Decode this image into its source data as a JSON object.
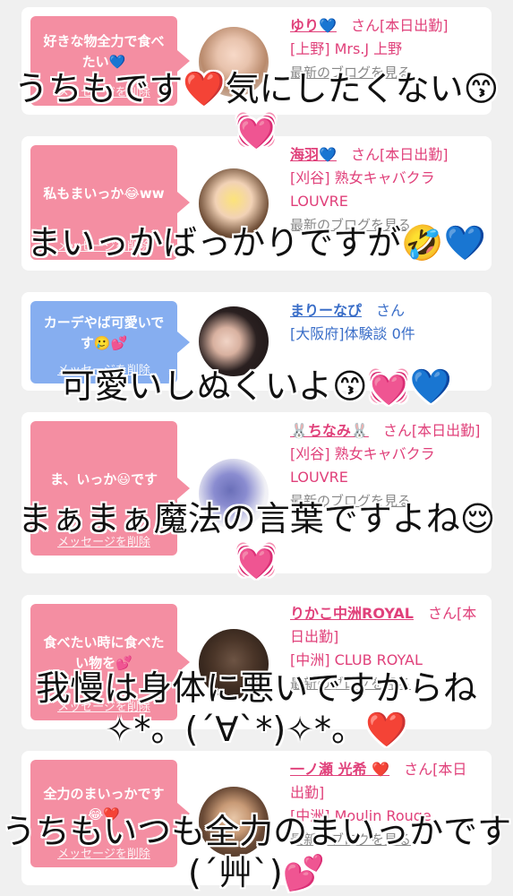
{
  "delete_label": "メッセージを削除",
  "san": "さん",
  "blog_label": "最新のブログを見る",
  "cards": [
    {
      "bubble": "好きな物全力で食べたい💙",
      "name": "ゆり💙",
      "status": "[本日出勤]",
      "shop": "[上野] Mrs.J 上野",
      "color": "pink"
    },
    {
      "bubble": "私もまいっか😂ww",
      "name": "海羽💙",
      "status": "[本日出勤]",
      "shop": "[刈谷] 熟女キャバクラ LOUVRE",
      "color": "pink"
    },
    {
      "bubble": "カーデやば可愛いです🥲💕",
      "name": "まりーなぴ",
      "status": "",
      "shop": "[大阪府]体験談 0件",
      "color": "blue"
    },
    {
      "bubble": "ま、いっか😃です",
      "name": "🐰ちなみ🐰",
      "status": "[本日出勤]",
      "shop": "[刈谷] 熟女キャバクラ LOUVRE",
      "color": "pink"
    },
    {
      "bubble": "食べたい時に食べたい物を💕",
      "name": "りかこ中洲ROYAL",
      "status": "[本日出勤]",
      "shop": "[中洲] CLUB ROYAL",
      "color": "pink"
    },
    {
      "bubble": "全力のまいっかです😂❤️",
      "name": "一ノ瀬 光希 ❤️",
      "status": "[本日出勤]",
      "shop": "[中洲] Moulin Rouge",
      "color": "pink"
    }
  ],
  "overlays": [
    "うちもです❤️気にしたくない😙💓",
    "まいっかばっかりですが🤣💙",
    "可愛いしぬくいよ😙💓💙",
    "まぁまぁ魔法の言葉ですよね😌💓",
    "我慢は身体に悪いですからね✧*。(´∀`*)✧*。❤️",
    "うちもいつも全力のまいっかです(´艸`)💕"
  ]
}
